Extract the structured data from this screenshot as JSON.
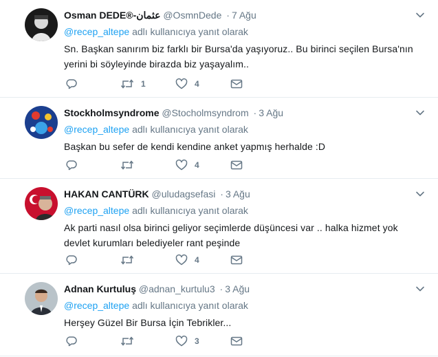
{
  "tweets": [
    {
      "fullname": "Osman DEDE®-عثمان",
      "username": "@OsmnDede",
      "dot": "·",
      "time": "7 Ağu",
      "reply_prefix": "",
      "reply_mention": "@recep_altepe",
      "reply_suffix": "adlı kullanıcıya yanıt olarak",
      "text_lines": [
        "Sn. Başkan sanırım biz farklı bir Bursa'da yaşıyoruz.. Bu birinci seçilen Bursa'nın",
        "yerini bi söyleyinde birazda biz yaşayalım.."
      ],
      "retweets": "1",
      "likes": "4"
    },
    {
      "fullname": "Stockholmsyndrome",
      "username": "@Stocholmsyndrom",
      "dot": "·",
      "time": "3 Ağu",
      "reply_mention": "@recep_altepe",
      "reply_suffix": "adlı kullanıcıya yanıt olarak",
      "text_lines": [
        "Başkan bu sefer de kendi kendine anket yapmış herhalde :D"
      ],
      "retweets": "",
      "likes": "4"
    },
    {
      "fullname": "HAKAN CANTÜRK",
      "username": "@uludagsefasi",
      "dot": "·",
      "time": "3 Ağu",
      "reply_mention": "@recep_altepe",
      "reply_suffix": "adlı kullanıcıya yanıt olarak",
      "text_lines": [
        "Ak parti nasıl olsa birinci geliyor seçimlerde düşüncesi var .. halka hizmet yok",
        "devlet kurumları belediyeler rant peşinde"
      ],
      "retweets": "",
      "likes": "4"
    },
    {
      "fullname": "Adnan Kurtuluş",
      "username": "@adnan_kurtulu3",
      "dot": "·",
      "time": "3 Ağu",
      "reply_mention": "@recep_altepe",
      "reply_suffix": "adlı kullanıcıya yanıt olarak",
      "text_lines": [
        "Herşey Güzel Bir Bursa İçin Tebrikler..."
      ],
      "retweets": "",
      "likes": "3"
    }
  ],
  "colors": {
    "link": "#1da1f2",
    "secondary_text": "#657786",
    "divider": "#e6ecf0",
    "icon": "#657786"
  }
}
